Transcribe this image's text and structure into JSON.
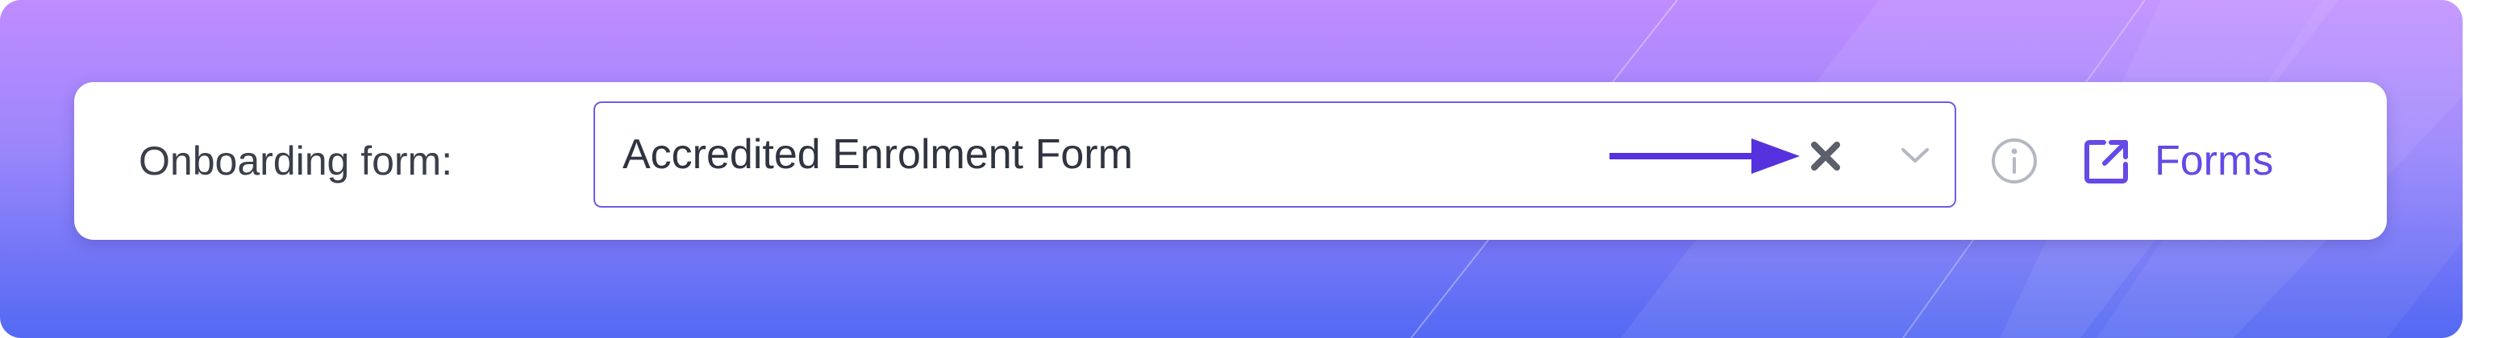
{
  "colors": {
    "gradient_top": "#c08cff",
    "gradient_bottom": "#5369f3",
    "accent": "#6649e6",
    "select_border": "#6f5ce6",
    "label_text": "#3a3f4a",
    "muted_icon": "#b4b8c2"
  },
  "field": {
    "label": "Onboarding form:",
    "selected_value": "Accredited Enrolment Form"
  },
  "icons": {
    "annotation_arrow": "arrow-right-icon",
    "clear": "close-icon",
    "dropdown": "chevron-down-icon",
    "info": "info-circle-icon",
    "external": "external-link-icon"
  },
  "link": {
    "label": "Forms"
  }
}
